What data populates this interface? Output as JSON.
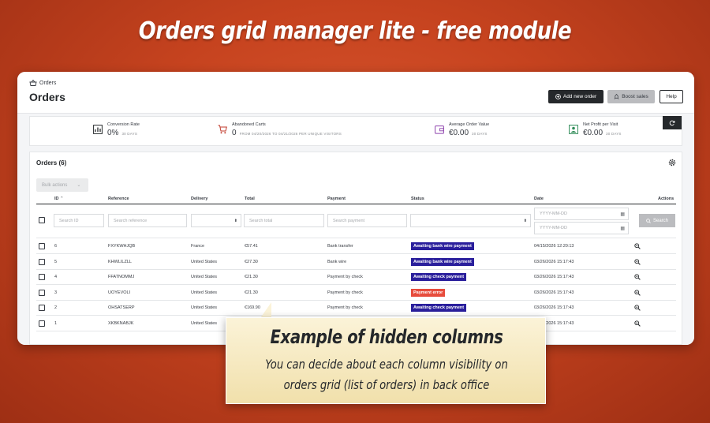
{
  "hero_title": "Orders grid manager lite - free module",
  "header": {
    "breadcrumb": "Orders",
    "title": "Orders",
    "add_order_label": "Add new order",
    "boost_label": "Boost sales",
    "help_label": "Help"
  },
  "kpis": [
    {
      "label": "Conversion Rate",
      "value": "0%",
      "sub": "30 DAYS",
      "icon": "bar-chart-icon",
      "color": "#25282b"
    },
    {
      "label": "Abandoned Carts",
      "value": "0",
      "sub": "FROM 04/20/2026 TO 04/21/2026 PER UNIQUE VISITORS",
      "icon": "cart-icon",
      "color": "#c0392b"
    },
    {
      "label": "Average Order Value",
      "value": "€0.00",
      "sub": "30 DAYS",
      "icon": "wallet-icon",
      "color": "#8e44ad"
    },
    {
      "label": "Net Profit per Visit",
      "value": "€0.00",
      "sub": "30 DAYS",
      "icon": "user-money-icon",
      "color": "#2e8b57"
    }
  ],
  "orders": {
    "title": "Orders (6)",
    "bulk_label": "Bulk actions",
    "columns": {
      "id": "ID",
      "reference": "Reference",
      "delivery": "Delivery",
      "total": "Total",
      "payment": "Payment",
      "status": "Status",
      "date": "Date",
      "actions": "Actions"
    },
    "filters": {
      "id": "Search ID",
      "reference": "Search reference",
      "total": "Search total",
      "payment": "Search payment",
      "date_from": "YYYY-MM-DD",
      "date_to": "YYYY-MM-DD",
      "search_label": "Search"
    },
    "rows": [
      {
        "id": "6",
        "reference": "FXYKWHJQB",
        "delivery": "France",
        "total": "€57.41",
        "payment": "Bank transfer",
        "status": "Awaiting bank wire payment",
        "status_color": "#2a1f9c",
        "date": "04/15/2026 12:20:13"
      },
      {
        "id": "5",
        "reference": "KHWLILZLL",
        "delivery": "United States",
        "total": "€27.30",
        "payment": "Bank wire",
        "status": "Awaiting bank wire payment",
        "status_color": "#2a1f9c",
        "date": "03/26/2026 15:17:43"
      },
      {
        "id": "4",
        "reference": "FFATNOMMJ",
        "delivery": "United States",
        "total": "€21.30",
        "payment": "Payment by check",
        "status": "Awaiting check payment",
        "status_color": "#2a1f9c",
        "date": "03/26/2026 15:17:43"
      },
      {
        "id": "3",
        "reference": "UOYEVOLI",
        "delivery": "United States",
        "total": "€21.30",
        "payment": "Payment by check",
        "status": "Payment error",
        "status_color": "#e74c3c",
        "date": "03/26/2026 15:17:43"
      },
      {
        "id": "2",
        "reference": "OHSATSERP",
        "delivery": "United States",
        "total": "€169.90",
        "payment": "Payment by check",
        "status": "Awaiting check payment",
        "status_color": "#2a1f9c",
        "date": "03/26/2026 15:17:43"
      },
      {
        "id": "1",
        "reference": "XKBKNABJK",
        "delivery": "United States",
        "total": "",
        "payment": "",
        "status": "",
        "status_color": "#2a1f9c",
        "date": "03/26/2026 15:17:43"
      }
    ]
  },
  "callout": {
    "title": "Example of hidden columns",
    "line1": "You can decide about each column visibility on",
    "line2": "orders grid (list of orders) in back office"
  }
}
